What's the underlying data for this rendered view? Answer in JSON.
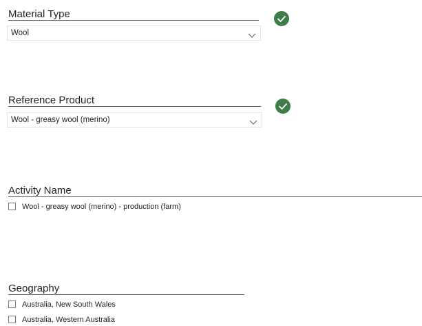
{
  "colors": {
    "check_badge": "#3d7d47",
    "text": "#252423",
    "rule": "#5f5f5f",
    "dropdown_border": "#e3e3e3"
  },
  "material_type": {
    "title": "Material Type",
    "selected": "Wool",
    "status_icon": "check-circle-icon"
  },
  "reference_product": {
    "title": "Reference Product",
    "selected": "Wool - greasy wool (merino)",
    "status_icon": "check-circle-icon"
  },
  "activity_name": {
    "title": "Activity Name",
    "options": [
      {
        "label": "Wool - greasy wool (merino) - production (farm)",
        "checked": false
      }
    ]
  },
  "geography": {
    "title": "Geography",
    "options": [
      {
        "label": "Australia, New South Wales",
        "checked": false
      },
      {
        "label": "Australia, Western Australia",
        "checked": false
      }
    ]
  }
}
